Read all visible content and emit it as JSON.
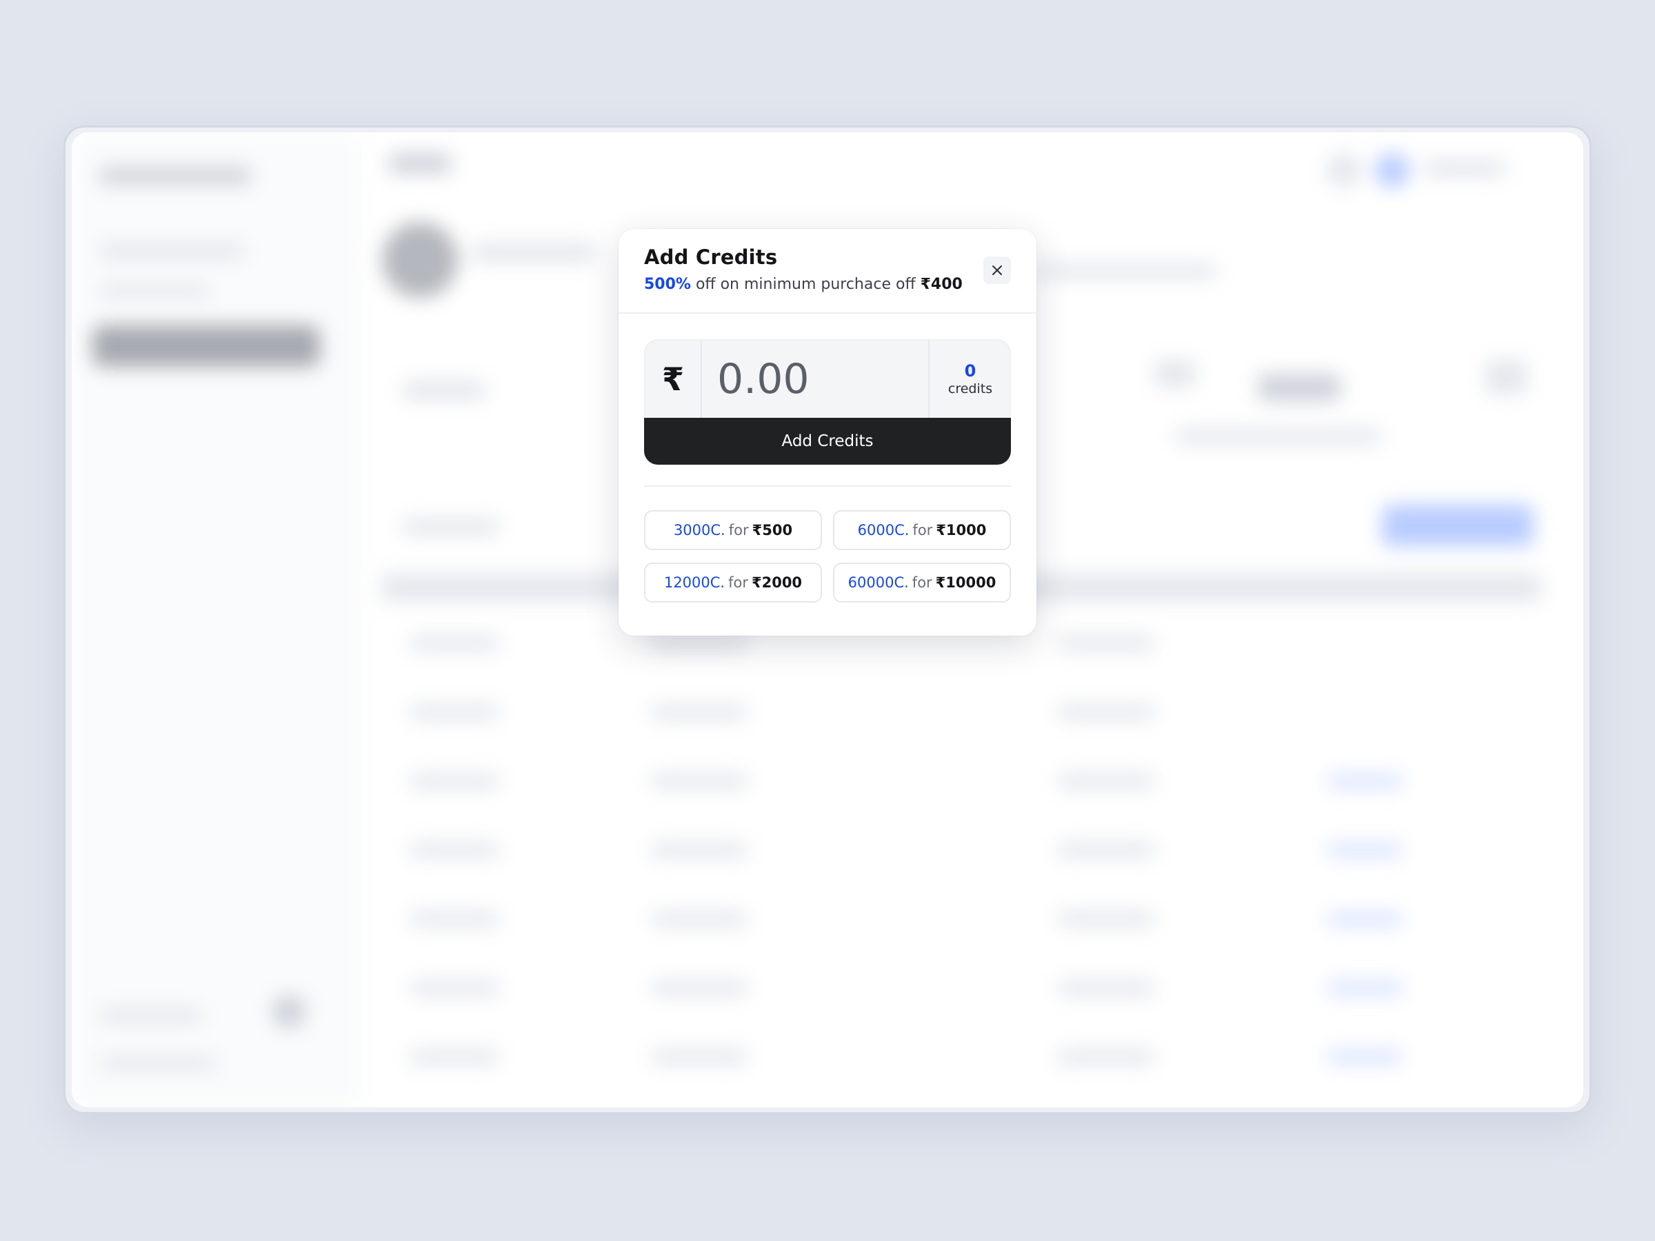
{
  "modal": {
    "title": "Add Credits",
    "offer": {
      "highlight": "500%",
      "text": " off on minimum purchace off ",
      "amount": "₹400"
    },
    "close_icon": "close-icon",
    "amount": {
      "currency_symbol": "₹",
      "placeholder": "0.00",
      "value": ""
    },
    "credits": {
      "count": "0",
      "label": "credits"
    },
    "submit_label": "Add Credits",
    "packages": [
      {
        "credits": "3000C.",
        "for": "for",
        "price": "₹500"
      },
      {
        "credits": "6000C.",
        "for": "for",
        "price": "₹1000"
      },
      {
        "credits": "12000C.",
        "for": "for",
        "price": "₹2000"
      },
      {
        "credits": "60000C.",
        "for": "for",
        "price": "₹10000"
      }
    ]
  },
  "colors": {
    "accent": "#1747e6",
    "button": "#202122",
    "backdrop": "#e1e5ee"
  }
}
